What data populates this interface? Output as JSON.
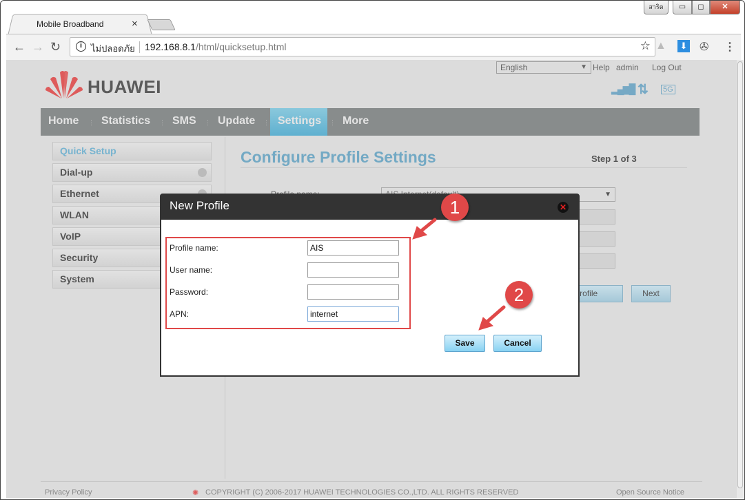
{
  "browser": {
    "tab_title": "Mobile Broadband",
    "window_profile_label": "สาริต",
    "security_label": "ไม่ปลอดภัย",
    "url_host": "192.168.8.1",
    "url_path": "/html/quicksetup.html"
  },
  "header": {
    "language": "English",
    "help": "Help",
    "user": "admin",
    "logout": "Log Out",
    "brand": "HUAWEI",
    "network_type": "5G"
  },
  "menu": [
    {
      "label": "Home"
    },
    {
      "label": "Statistics"
    },
    {
      "label": "SMS"
    },
    {
      "label": "Update"
    },
    {
      "label": "Settings",
      "active": true
    },
    {
      "label": "More"
    }
  ],
  "sidebar": [
    {
      "label": "Quick Setup",
      "active": true
    },
    {
      "label": "Dial-up"
    },
    {
      "label": "Ethernet"
    },
    {
      "label": "WLAN"
    },
    {
      "label": "VoIP"
    },
    {
      "label": "Security"
    },
    {
      "label": "System"
    }
  ],
  "main": {
    "title": "Configure Profile Settings",
    "step": "Step 1 of 3",
    "profile_label": "Profile name:",
    "profile_selected": "AIS Internet(default)",
    "new_profile_button": "New Profile",
    "next_button": "Next"
  },
  "dialog": {
    "title": "New Profile",
    "fields": [
      {
        "label": "Profile name:",
        "value": "AIS"
      },
      {
        "label": "User name:",
        "value": ""
      },
      {
        "label": "Password:",
        "value": ""
      },
      {
        "label": "APN:",
        "value": "internet"
      }
    ],
    "save": "Save",
    "cancel": "Cancel"
  },
  "annotations": {
    "first": "1",
    "second": "2"
  },
  "footer": {
    "privacy": "Privacy Policy",
    "copyright": "COPYRIGHT (C) 2006-2017 HUAWEI TECHNOLOGIES CO.,LTD. ALL RIGHTS RESERVED",
    "open_source": "Open Source Notice"
  },
  "colors": {
    "accent": "#5fb0d0",
    "annotation": "#e04848",
    "menubar": "#888c8c"
  }
}
